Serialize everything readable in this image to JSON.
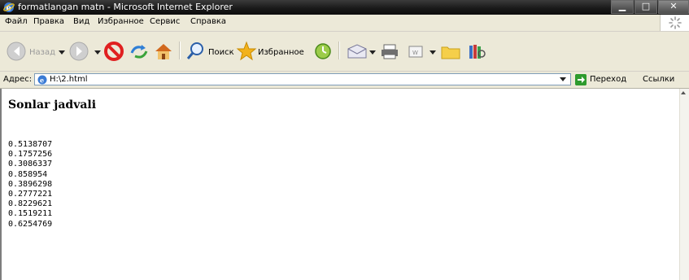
{
  "window": {
    "title": "formatlangan matn - Microsoft Internet Explorer",
    "controls": {
      "minimize": "▁",
      "maximize": "□",
      "close": "✕"
    }
  },
  "menu": [
    "Файл",
    "Правка",
    "Вид",
    "Избранное",
    "Сервис",
    "Справка"
  ],
  "toolbar": {
    "back_label": "Назад",
    "search_label": "Поиск",
    "favorites_label": "Избранное",
    "icons": [
      "back-icon",
      "forward-icon",
      "stop-icon",
      "refresh-icon",
      "home-icon",
      "search-icon",
      "favorites-star-icon",
      "history-icon",
      "mail-icon",
      "print-icon",
      "edit-icon",
      "folder-icon",
      "research-icon"
    ]
  },
  "address": {
    "label": "Адрес:",
    "value": "H:\\2.html",
    "go_label": "Переход",
    "links_label": "Ссылки"
  },
  "page": {
    "heading": "Sonlar jadvali",
    "numbers": [
      "0.5138707",
      "0.1757256",
      "0.3086337",
      "0.858954",
      "0.3896298",
      "0.2777221",
      "0.8229621",
      "0.1519211",
      "0.6254769"
    ]
  },
  "colors": {
    "titlebar": "#1a1a1a",
    "chrome": "#ece9d8",
    "stop_red": "#e02020",
    "go_green": "#2e9b2e"
  }
}
